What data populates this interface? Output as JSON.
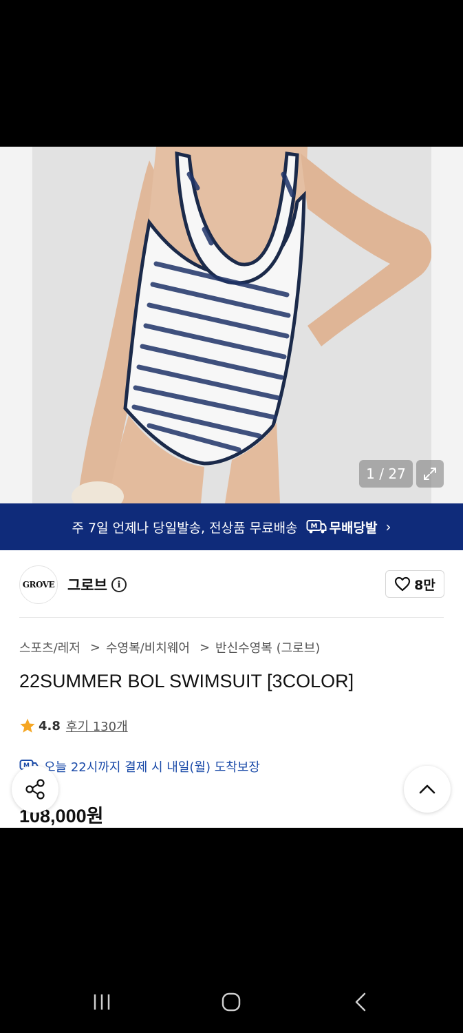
{
  "gallery": {
    "counter": "1 / 27",
    "expand_icon": "expand-icon",
    "image_alt": "swimsuit product photo"
  },
  "banner": {
    "text": "주 7일 언제나 당일발송, 전상품 무료배송",
    "badge_label": "무배당발",
    "chevron": "›",
    "color": "#0f2b7a"
  },
  "brand": {
    "logo_text": "GROVE",
    "name": "그로브",
    "info_symbol": "i"
  },
  "like": {
    "count": "8만"
  },
  "breadcrumb": {
    "items": [
      "스포츠/레저",
      "수영복/비치웨어",
      "반신수영복 (그로브)"
    ],
    "separator": ">"
  },
  "product": {
    "title": "22SUMMER BOL SWIMSUIT [3COLOR]",
    "rating": "4.8",
    "review_text": "후기 130개",
    "delivery_text": "오늘 22시까지 결제 시 내일(월) 도착보장",
    "price": "108,000원",
    "star_color": "#f5a623",
    "delivery_color": "#1a4aa8"
  },
  "fabs": {
    "share_icon": "share-icon",
    "scroll_top_icon": "chevron-up-icon"
  },
  "system_nav": {
    "recent_icon": "recent-apps-icon",
    "home_icon": "home-icon",
    "back_icon": "back-icon"
  }
}
